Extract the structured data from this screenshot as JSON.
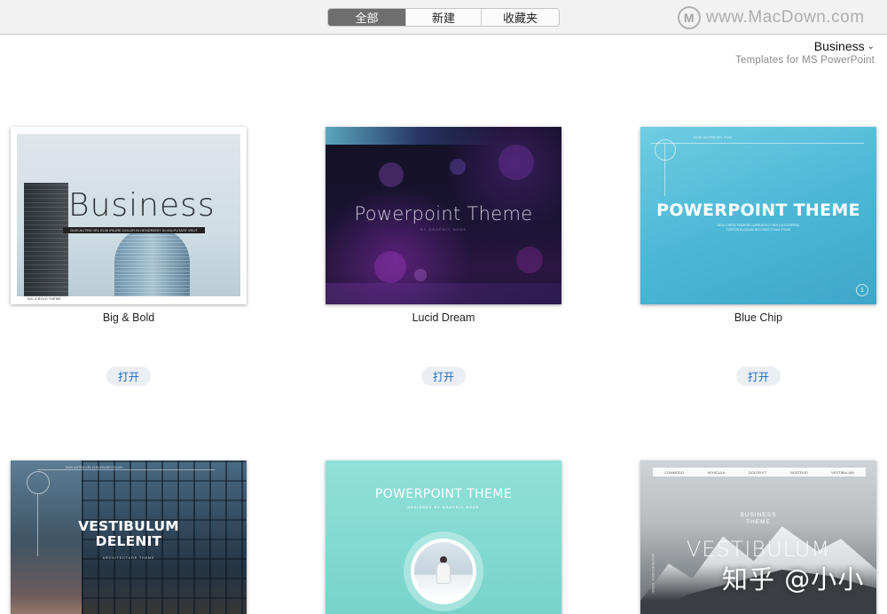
{
  "toolbar": {
    "tabs": [
      {
        "label": "全部",
        "active": true
      },
      {
        "label": "新建",
        "active": false
      },
      {
        "label": "收藏夹",
        "active": false
      }
    ]
  },
  "watermark": {
    "logo": "M",
    "text": "www.MacDown.com"
  },
  "category": {
    "title": "Business",
    "subtitle": "Templates for MS PowerPoint",
    "chevron_icon": "chevron-down-icon"
  },
  "templates": [
    {
      "name": "Big & Bold",
      "open_label": "打开",
      "preview": {
        "title": "Business",
        "strap": "DUIS AUTEM VEL EUM IRIURE DOLOR IN HENDRERIT IN VULPUTATE VELIT",
        "footer": "BIG & BOLD THEME"
      }
    },
    {
      "name": "Lucid Dream",
      "open_label": "打开",
      "preview": {
        "title": "Powerpoint Theme",
        "subtitle": "BY GRAPHIC NODE"
      }
    },
    {
      "name": "Blue Chip",
      "open_label": "打开",
      "preview": {
        "title": "POWERPOINT THEME",
        "subtitle": "SEM LOREM TEMPOR CURSUS ELIT MOLLIS ELEIFEND TORTOR ALIQUAM NISI ERAT ETIAM IPSUM",
        "header": "DUIS AUTEM VEL EUM",
        "page": "1"
      }
    },
    {
      "preview": {
        "title_line1": "VESTIBULUM",
        "title_line2": "DELENIT",
        "subtitle": "ARCHITECTURE THEME",
        "header": "DUIS AUTEM VEL EUM IRIURE DOLOR"
      }
    },
    {
      "preview": {
        "title": "POWERPOINT THEME",
        "subtitle": "DESIGNED BY GRAPHIC NODE"
      }
    },
    {
      "preview": {
        "nav": [
          "COMMODO",
          "VEHICULA",
          "DOLOR ET",
          "NOSTRUD",
          "VESTIBULUM"
        ],
        "title_line1": "BUSINESS",
        "title_line2": "THEME",
        "big": "VESTIBULUM",
        "side": "NOSTRUD EXERCI TATION"
      }
    }
  ],
  "overlay": {
    "text": "知乎 @小小"
  }
}
